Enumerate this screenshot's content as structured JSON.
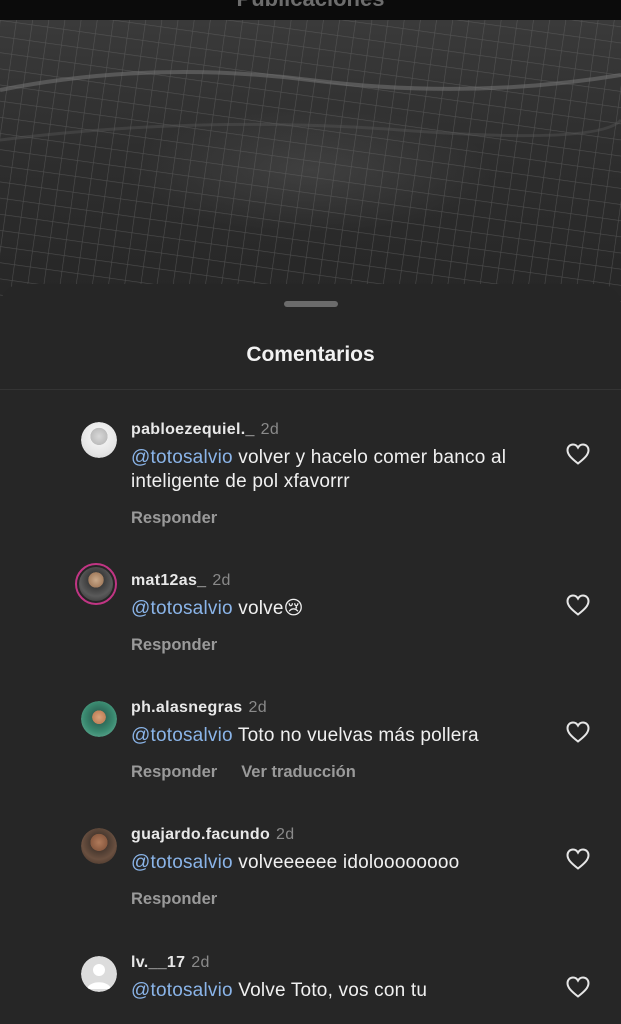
{
  "header": {
    "title": "Publicaciones"
  },
  "sheet": {
    "title": "Comentarios"
  },
  "comments": [
    {
      "username": "pabloezequiel._",
      "age": "2d",
      "mention": "@totosalvio",
      "text": " volver y hacelo comer banco al inteligente de pol xfavorrr",
      "reply_label": "Responder"
    },
    {
      "username": "mat12as_",
      "age": "2d",
      "mention": "@totosalvio",
      "text": " volve😢",
      "reply_label": "Responder"
    },
    {
      "username": "ph.alasnegras",
      "age": "2d",
      "mention": "@totosalvio",
      "text": " Toto no vuelvas más pollera",
      "reply_label": "Responder",
      "translate_label": "Ver traducción"
    },
    {
      "username": "guajardo.facundo",
      "age": "2d",
      "mention": "@totosalvio",
      "text": " volveeeeee idoloooooooo",
      "reply_label": "Responder"
    },
    {
      "username": "lv.__17",
      "age": "2d",
      "mention": "@totosalvio",
      "text": " Volve Toto, vos con tu"
    }
  ],
  "icons": {
    "like": "heart-outline-icon"
  },
  "colors": {
    "sheet_bg": "#262626",
    "mention": "#8ab4e8",
    "story_ring": "#c13584"
  }
}
